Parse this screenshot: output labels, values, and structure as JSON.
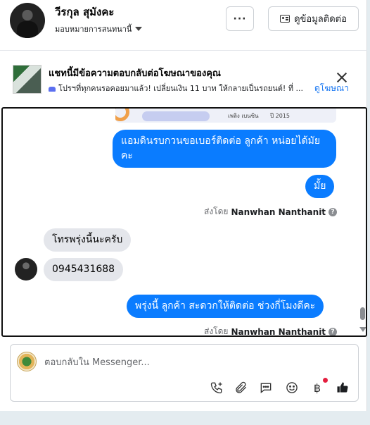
{
  "header": {
    "contact_name": "วีรกุล สุมังคะ",
    "assign_label": "มอบหมายการสนทนานี้",
    "more_label": "···",
    "contact_info_label": "ดูข้อมูลติดต่อ"
  },
  "ad_banner": {
    "title": "แชทนี้มีข้อความตอบกลับต่อโฆษณาของคุณ",
    "subtitle": "โปรฯที่ทุกคนรอคอยมาแล้ว! เปลี่ยนเงิน 11 บาท ให้กลายเป็นรถยนต์! ที่ ...",
    "link": "ดูโฆษณา"
  },
  "image_preview": {
    "text_1": "เพลิง เบนซิน",
    "text_2": "ปี 2015"
  },
  "messages": [
    {
      "side": "out",
      "text": "แอมดินรบกวนขอเบอร์ติดต่อ ลูกค้า หน่อยได้มัยคะ"
    },
    {
      "side": "out",
      "text": "มั้ย"
    },
    {
      "side": "meta",
      "prefix": "ส่งโดย",
      "sender": "Nanwhan Nanthanit"
    },
    {
      "side": "in",
      "text": "โทรพรุ่งนี้นะครับ"
    },
    {
      "side": "in",
      "text": "0945431688"
    },
    {
      "side": "out",
      "text": "พรุ่งนี้ ลูกค้า สะดวกให้ติดต่อ ช่วงกี่โมงดีคะ"
    },
    {
      "side": "meta",
      "prefix": "ส่งโดย",
      "sender": "Nanwhan Nanthanit"
    }
  ],
  "composer": {
    "placeholder": "ตอบกลับใน Messenger...",
    "tools": [
      "call-plus-icon",
      "paperclip-icon",
      "chat-bubble-icon",
      "emoji-icon",
      "baht-icon",
      "thumbs-up-icon"
    ],
    "baht_symbol": "฿"
  },
  "colors": {
    "outgoing_bubble": "#0a7cff",
    "incoming_bubble": "#e4e6eb",
    "link": "#1877f2",
    "alert_dot": "#e41e3f"
  }
}
